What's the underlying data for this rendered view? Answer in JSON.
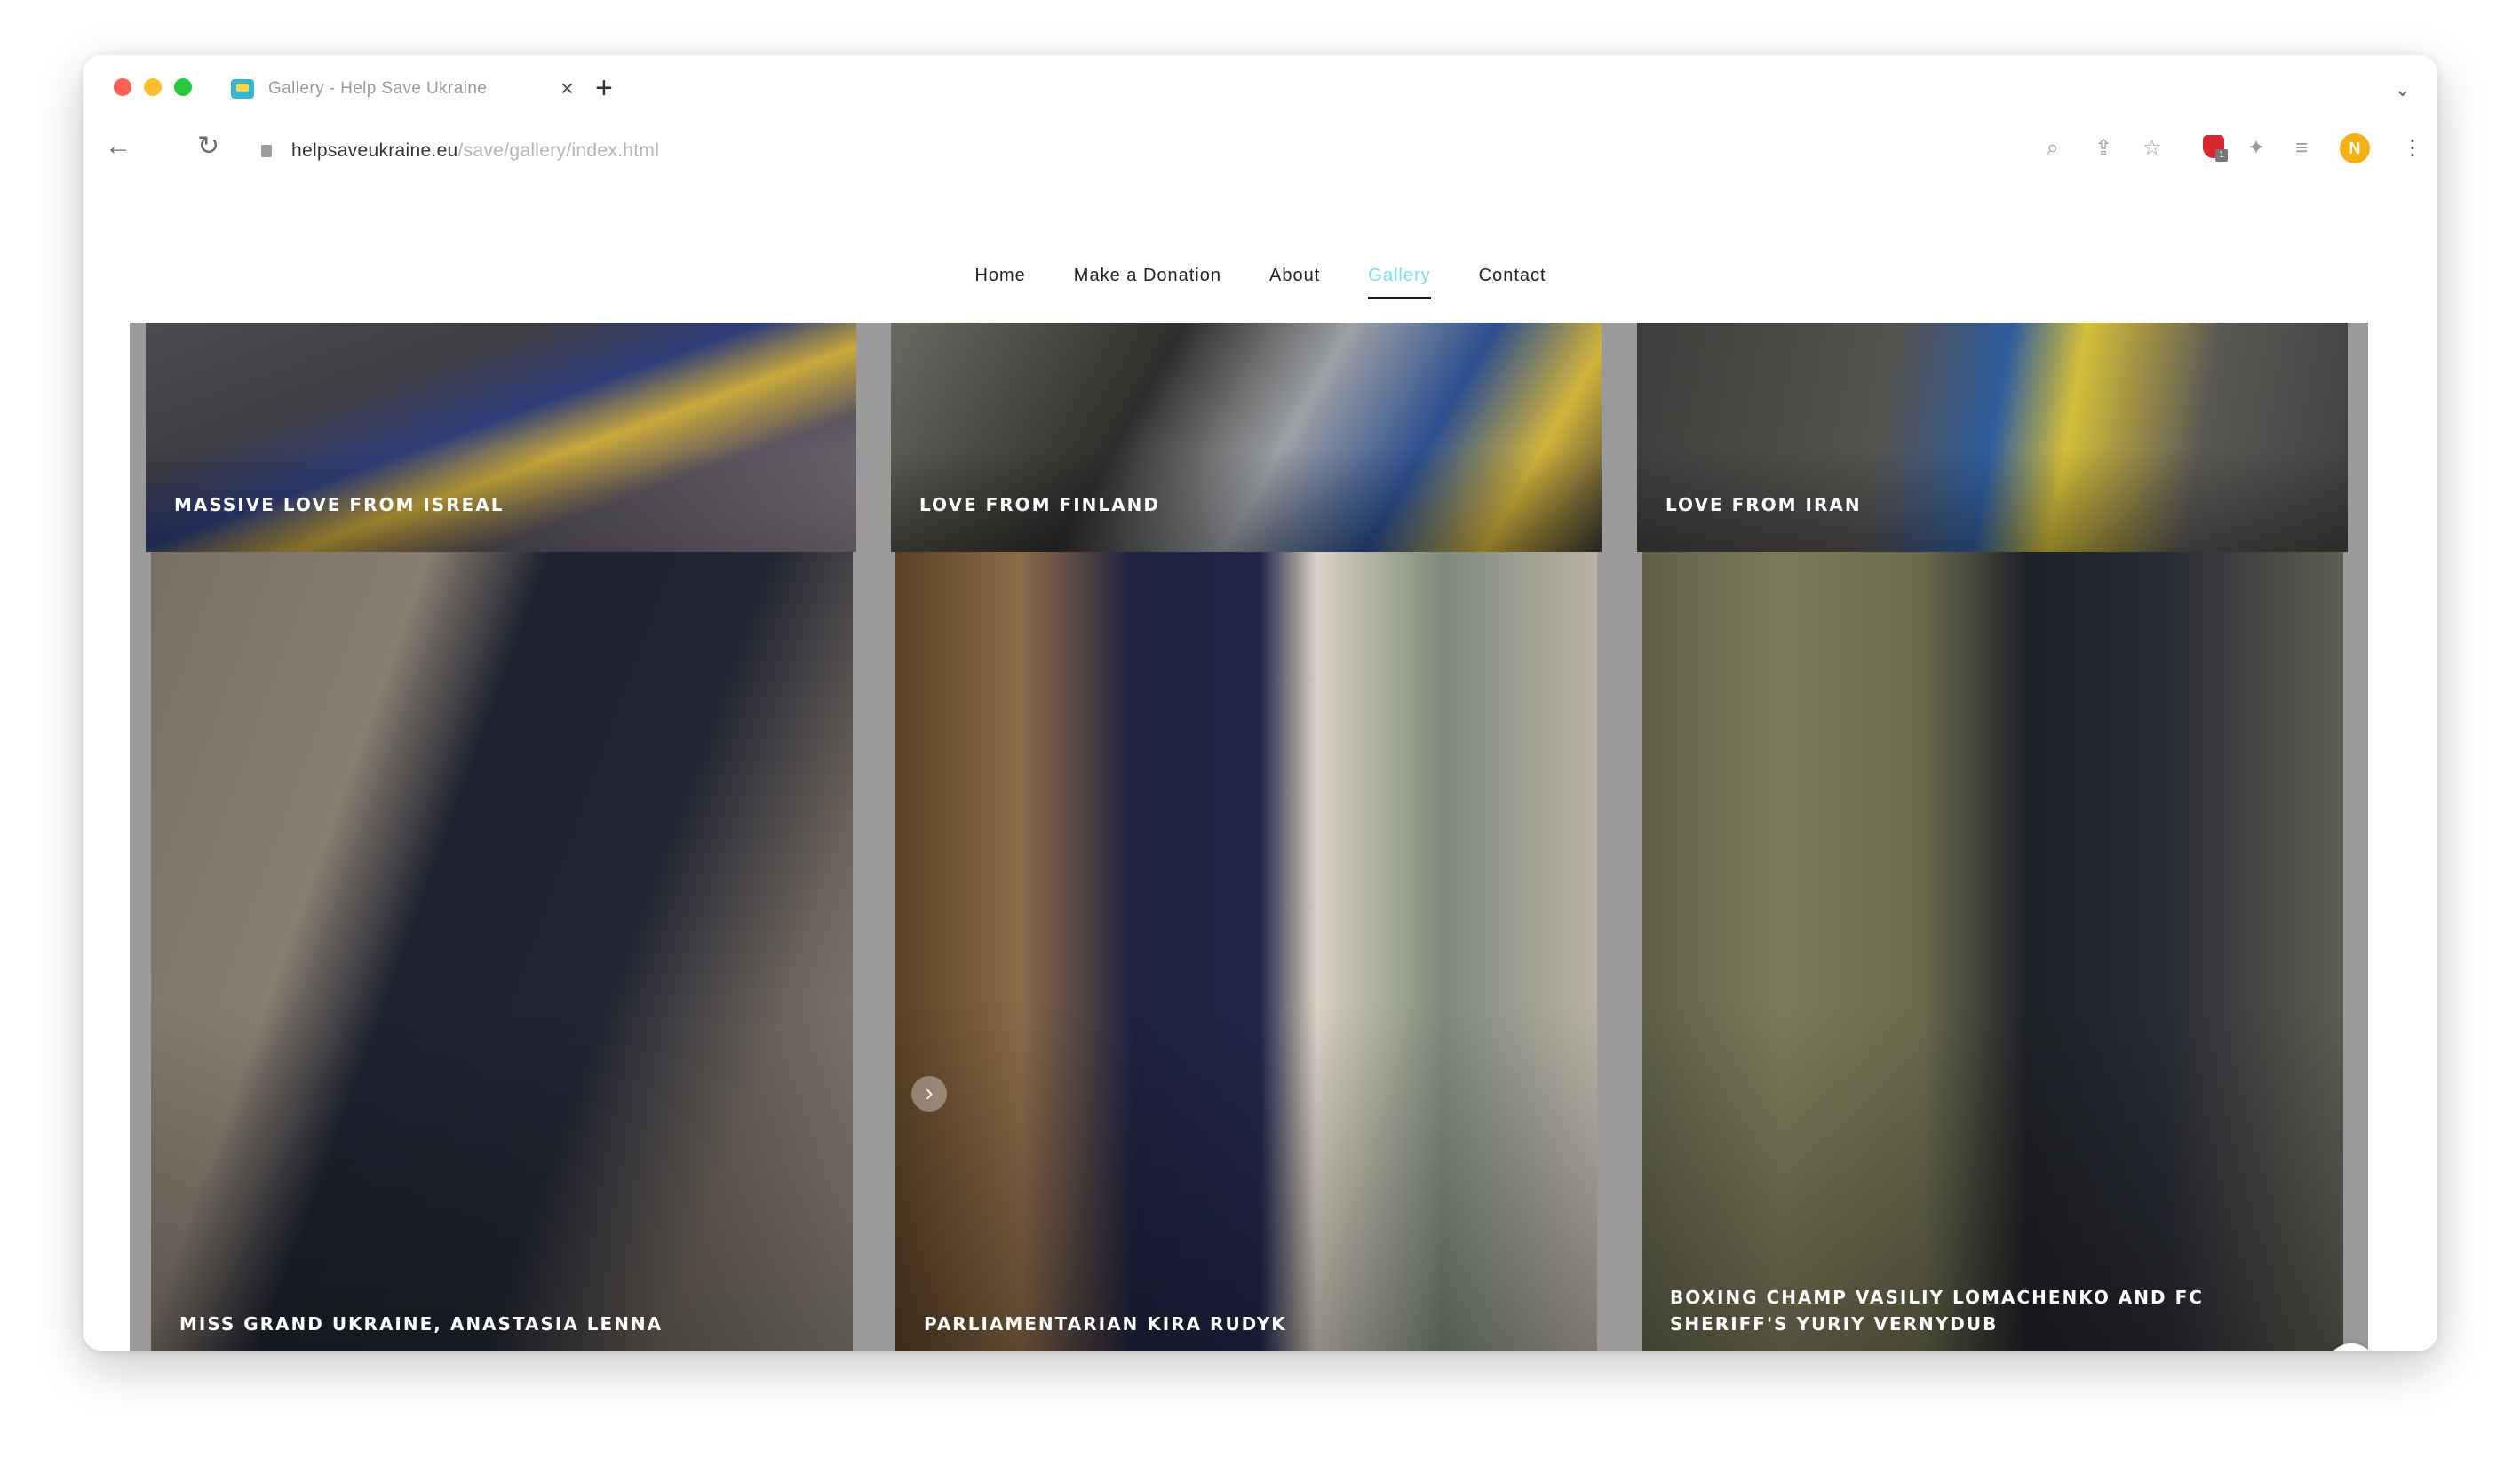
{
  "browser": {
    "tab_title": "Gallery - Help Save Ukraine",
    "tab_close": "×",
    "new_tab": "+",
    "tab_menu": "⌄",
    "url_host": "helpsaveukraine.eu",
    "url_path": "/save/gallery/index.html",
    "back": "←",
    "reload": "↻",
    "zoom_icon": "⌕",
    "share_icon": "⇪",
    "bookmark_icon": "☆",
    "puzzle_icon": "✦",
    "media_icon": "≡",
    "menu_icon": "⋮",
    "extension_badge": "1",
    "avatar_initial": "N"
  },
  "nav": {
    "home": "Home",
    "donation": "Make a Donation",
    "about": "About",
    "gallery": "Gallery",
    "contact": "Contact"
  },
  "gallery": {
    "items": [
      {
        "caption": "Massive love from Isreal"
      },
      {
        "caption": "Love from Finland"
      },
      {
        "caption": "Love from Iran"
      },
      {
        "caption": "Miss Grand Ukraine, Anastasia Lenna"
      },
      {
        "caption": "Parliamentarian Kira Rudyk"
      },
      {
        "caption": "Boxing champ Vasiliy Lomachenko and FC Sheriff's Yuriy Vernydub"
      }
    ],
    "next_arrow": "›",
    "scroll_top": "˄"
  },
  "colors": {
    "accent_active_nav": "#7fe0f0",
    "overlay_gray": "#9a9a9a",
    "avatar": "#f5b016"
  }
}
